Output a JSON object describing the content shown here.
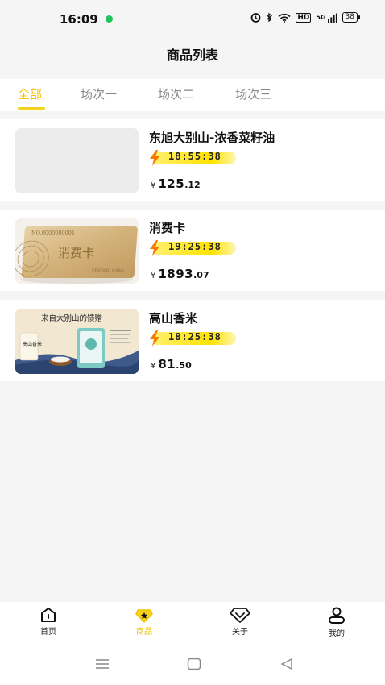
{
  "status": {
    "time": "16:09",
    "network": "5G",
    "battery": "38"
  },
  "header": {
    "title": "商品列表"
  },
  "tabs": [
    {
      "label": "全部",
      "active": true
    },
    {
      "label": "场次一",
      "active": false
    },
    {
      "label": "场次二",
      "active": false
    },
    {
      "label": "场次三",
      "active": false
    }
  ],
  "products": [
    {
      "name": "东旭大别山-浓香菜籽油",
      "timer": "18:55:38",
      "currency": "¥",
      "price_int": "125",
      "price_dec": ".12",
      "image": "placeholder"
    },
    {
      "name": "消费卡",
      "timer": "19:25:38",
      "currency": "¥",
      "price_int": "1893",
      "price_dec": ".07",
      "image": "prepaid-card",
      "card_number": "NO.0000000001",
      "card_title": "消费卡",
      "card_caption": "PREPAID CARD"
    },
    {
      "name": "高山香米",
      "timer": "18:25:38",
      "currency": "¥",
      "price_int": "81",
      "price_dec": ".50",
      "image": "rice-bag",
      "banner_text": "来自大别山的馈赠",
      "bag_label": "高山香米"
    }
  ],
  "tabbar": [
    {
      "label": "首页",
      "icon": "home-icon",
      "active": false
    },
    {
      "label": "商品",
      "icon": "goods-icon",
      "active": true
    },
    {
      "label": "关于",
      "icon": "diamond-icon",
      "active": false
    },
    {
      "label": "我的",
      "icon": "user-icon",
      "active": false
    }
  ],
  "colors": {
    "accent": "#f5c400",
    "timer_bg": "#ffe200",
    "bolt": "#f57c00"
  }
}
